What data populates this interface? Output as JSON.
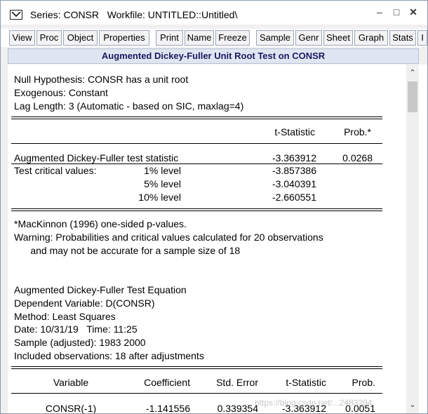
{
  "window": {
    "title": "Series: CONSR   Workfile: UNTITLED::Untitled\\",
    "controls": {
      "minimize": "–",
      "maximize": "□",
      "close": "✕"
    }
  },
  "toolbar": {
    "buttons": [
      "View",
      "Proc",
      "Object",
      "Properties",
      "Print",
      "Name",
      "Freeze",
      "Sample",
      "Genr",
      "Sheet",
      "Graph",
      "Stats",
      "I"
    ]
  },
  "header": {
    "title": "Augmented Dickey-Fuller Unit Root Test on CONSR"
  },
  "content": {
    "hypothesis": [
      "Null Hypothesis: CONSR has a unit root",
      "Exogenous: Constant",
      "Lag Length: 3 (Automatic - based on SIC, maxlag=4)"
    ],
    "table1": {
      "headers": {
        "tstat": "t-Statistic",
        "prob": "Prob.*"
      },
      "adf_row": {
        "label": "Augmented Dickey-Fuller test statistic",
        "tstat": "-3.363912",
        "prob": "0.0268"
      },
      "critical_label": "Test critical values:",
      "critical": [
        {
          "level": "1% level",
          "value": "-3.857386"
        },
        {
          "level": "5% level",
          "value": "-3.040391"
        },
        {
          "level": "10% level",
          "value": "-2.660551"
        }
      ]
    },
    "notes": [
      "*MacKinnon (1996) one-sided p-values.",
      "Warning: Probabilities and critical values calculated for 20 observations",
      "      and may not be accurate for a sample size of 18"
    ],
    "equation": [
      "Augmented Dickey-Fuller Test Equation",
      "Dependent Variable: D(CONSR)",
      "Method: Least Squares",
      "Date: 10/31/19   Time: 11:25",
      "Sample (adjusted): 1983 2000",
      "Included observations: 18 after adjustments"
    ],
    "table2": {
      "headers": {
        "variable": "Variable",
        "coefficient": "Coefficient",
        "stderr": "Std. Error",
        "tstat": "t-Statistic",
        "prob": "Prob."
      },
      "row": {
        "variable": "CONSR(-1)",
        "coefficient": "-1.141556",
        "stderr": "0.339354",
        "tstat": "-3.363912",
        "prob": "0.0051"
      }
    }
  },
  "watermark": "https://blog.csdn.net/...2483394"
}
